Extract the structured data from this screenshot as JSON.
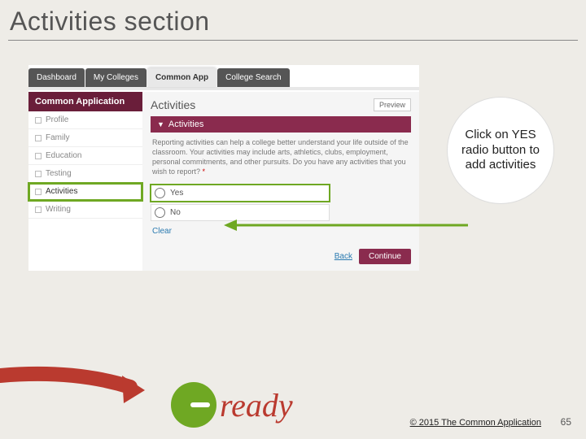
{
  "slide": {
    "title": "Activities section",
    "page_number": "65",
    "copyright": "© 2015 The Common Application"
  },
  "logo": {
    "text": "ready"
  },
  "callout": {
    "text": "Click on YES radio button to add activities"
  },
  "app": {
    "tabs": {
      "dashboard": "Dashboard",
      "my_colleges": "My Colleges",
      "common_app": "Common App",
      "college_search": "College Search"
    },
    "sidebar": {
      "header": "Common Application",
      "items": {
        "profile": "Profile",
        "family": "Family",
        "education": "Education",
        "testing": "Testing",
        "activities": "Activities",
        "writing": "Writing"
      }
    },
    "main": {
      "heading": "Activities",
      "preview": "Preview",
      "section_header": "Activities",
      "description": "Reporting activities can help a college better understand your life outside of the classroom. Your activities may include arts, athletics, clubs, employment, personal commitments, and other pursuits. Do you have any activities that you wish to report?",
      "required_mark": "*",
      "options": {
        "yes": "Yes",
        "no": "No"
      },
      "clear": "Clear",
      "back": "Back",
      "continue": "Continue"
    }
  }
}
